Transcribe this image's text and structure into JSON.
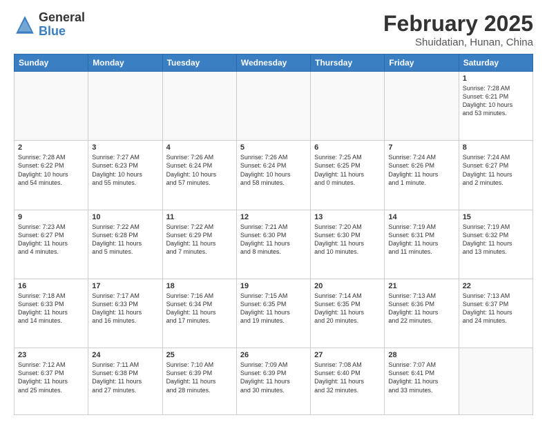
{
  "header": {
    "logo_general": "General",
    "logo_blue": "Blue",
    "month_title": "February 2025",
    "location": "Shuidatian, Hunan, China"
  },
  "days_of_week": [
    "Sunday",
    "Monday",
    "Tuesday",
    "Wednesday",
    "Thursday",
    "Friday",
    "Saturday"
  ],
  "weeks": [
    [
      {
        "day": "",
        "info": ""
      },
      {
        "day": "",
        "info": ""
      },
      {
        "day": "",
        "info": ""
      },
      {
        "day": "",
        "info": ""
      },
      {
        "day": "",
        "info": ""
      },
      {
        "day": "",
        "info": ""
      },
      {
        "day": "1",
        "info": "Sunrise: 7:28 AM\nSunset: 6:21 PM\nDaylight: 10 hours\nand 53 minutes."
      }
    ],
    [
      {
        "day": "2",
        "info": "Sunrise: 7:28 AM\nSunset: 6:22 PM\nDaylight: 10 hours\nand 54 minutes."
      },
      {
        "day": "3",
        "info": "Sunrise: 7:27 AM\nSunset: 6:23 PM\nDaylight: 10 hours\nand 55 minutes."
      },
      {
        "day": "4",
        "info": "Sunrise: 7:26 AM\nSunset: 6:24 PM\nDaylight: 10 hours\nand 57 minutes."
      },
      {
        "day": "5",
        "info": "Sunrise: 7:26 AM\nSunset: 6:24 PM\nDaylight: 10 hours\nand 58 minutes."
      },
      {
        "day": "6",
        "info": "Sunrise: 7:25 AM\nSunset: 6:25 PM\nDaylight: 11 hours\nand 0 minutes."
      },
      {
        "day": "7",
        "info": "Sunrise: 7:24 AM\nSunset: 6:26 PM\nDaylight: 11 hours\nand 1 minute."
      },
      {
        "day": "8",
        "info": "Sunrise: 7:24 AM\nSunset: 6:27 PM\nDaylight: 11 hours\nand 2 minutes."
      }
    ],
    [
      {
        "day": "9",
        "info": "Sunrise: 7:23 AM\nSunset: 6:27 PM\nDaylight: 11 hours\nand 4 minutes."
      },
      {
        "day": "10",
        "info": "Sunrise: 7:22 AM\nSunset: 6:28 PM\nDaylight: 11 hours\nand 5 minutes."
      },
      {
        "day": "11",
        "info": "Sunrise: 7:22 AM\nSunset: 6:29 PM\nDaylight: 11 hours\nand 7 minutes."
      },
      {
        "day": "12",
        "info": "Sunrise: 7:21 AM\nSunset: 6:30 PM\nDaylight: 11 hours\nand 8 minutes."
      },
      {
        "day": "13",
        "info": "Sunrise: 7:20 AM\nSunset: 6:30 PM\nDaylight: 11 hours\nand 10 minutes."
      },
      {
        "day": "14",
        "info": "Sunrise: 7:19 AM\nSunset: 6:31 PM\nDaylight: 11 hours\nand 11 minutes."
      },
      {
        "day": "15",
        "info": "Sunrise: 7:19 AM\nSunset: 6:32 PM\nDaylight: 11 hours\nand 13 minutes."
      }
    ],
    [
      {
        "day": "16",
        "info": "Sunrise: 7:18 AM\nSunset: 6:33 PM\nDaylight: 11 hours\nand 14 minutes."
      },
      {
        "day": "17",
        "info": "Sunrise: 7:17 AM\nSunset: 6:33 PM\nDaylight: 11 hours\nand 16 minutes."
      },
      {
        "day": "18",
        "info": "Sunrise: 7:16 AM\nSunset: 6:34 PM\nDaylight: 11 hours\nand 17 minutes."
      },
      {
        "day": "19",
        "info": "Sunrise: 7:15 AM\nSunset: 6:35 PM\nDaylight: 11 hours\nand 19 minutes."
      },
      {
        "day": "20",
        "info": "Sunrise: 7:14 AM\nSunset: 6:35 PM\nDaylight: 11 hours\nand 20 minutes."
      },
      {
        "day": "21",
        "info": "Sunrise: 7:13 AM\nSunset: 6:36 PM\nDaylight: 11 hours\nand 22 minutes."
      },
      {
        "day": "22",
        "info": "Sunrise: 7:13 AM\nSunset: 6:37 PM\nDaylight: 11 hours\nand 24 minutes."
      }
    ],
    [
      {
        "day": "23",
        "info": "Sunrise: 7:12 AM\nSunset: 6:37 PM\nDaylight: 11 hours\nand 25 minutes."
      },
      {
        "day": "24",
        "info": "Sunrise: 7:11 AM\nSunset: 6:38 PM\nDaylight: 11 hours\nand 27 minutes."
      },
      {
        "day": "25",
        "info": "Sunrise: 7:10 AM\nSunset: 6:39 PM\nDaylight: 11 hours\nand 28 minutes."
      },
      {
        "day": "26",
        "info": "Sunrise: 7:09 AM\nSunset: 6:39 PM\nDaylight: 11 hours\nand 30 minutes."
      },
      {
        "day": "27",
        "info": "Sunrise: 7:08 AM\nSunset: 6:40 PM\nDaylight: 11 hours\nand 32 minutes."
      },
      {
        "day": "28",
        "info": "Sunrise: 7:07 AM\nSunset: 6:41 PM\nDaylight: 11 hours\nand 33 minutes."
      },
      {
        "day": "",
        "info": ""
      }
    ]
  ]
}
